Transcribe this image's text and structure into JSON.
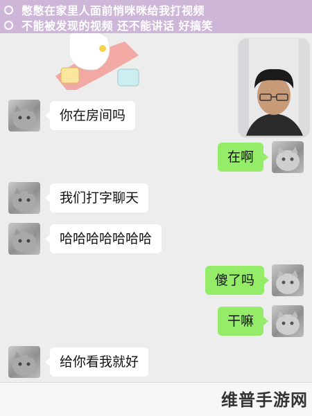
{
  "caption": {
    "line1": "憋憋在家里人面前悄咪咪给我打视频",
    "line2": "不能被发现的视频 还不能讲话 好搞笑",
    "color": "#cdb6d8"
  },
  "messages": [
    {
      "side": "in",
      "text": "你在房间吗"
    },
    {
      "side": "out",
      "text": "在啊"
    },
    {
      "side": "in",
      "text": "我们打字聊天"
    },
    {
      "side": "in",
      "text": "哈哈哈哈哈哈哈"
    },
    {
      "side": "out",
      "text": "傻了吗"
    },
    {
      "side": "out",
      "text": "干嘛"
    },
    {
      "side": "in",
      "text": "给你看我就好"
    }
  ],
  "watermark": "维普手游网",
  "colors": {
    "outgoing_bubble": "#95ec69",
    "incoming_bubble": "#ffffff",
    "background": "#ededed"
  }
}
